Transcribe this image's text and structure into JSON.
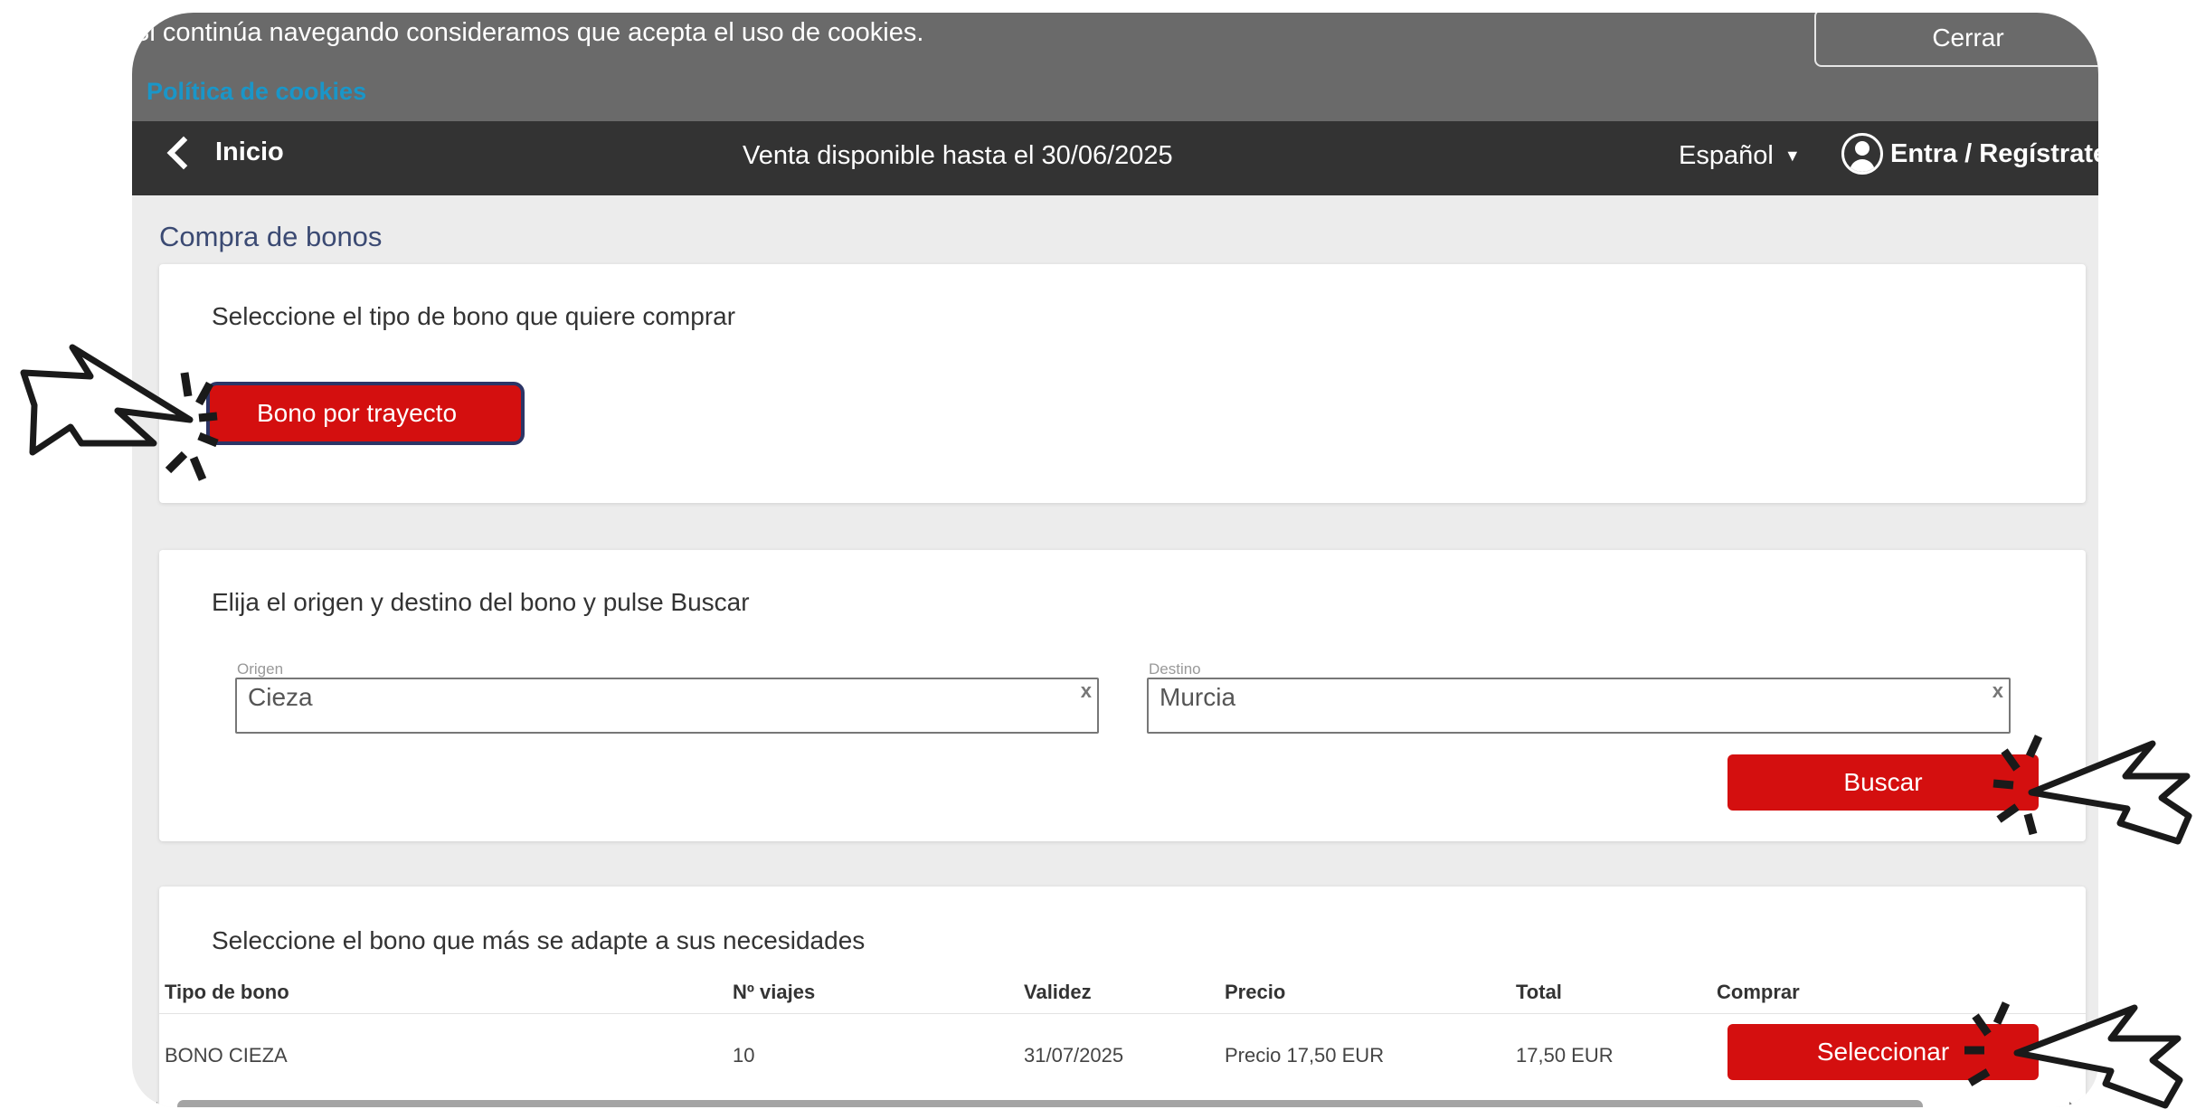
{
  "cookie": {
    "text": "Si continúa navegando consideramos que acepta el uso de cookies.",
    "policy_link": "Política de cookies",
    "close_label": "Cerrar"
  },
  "nav": {
    "back_label": "Inicio",
    "center_text": "Venta disponible hasta el 30/06/2025",
    "language": "Español",
    "login_label": "Entra / Regístrate"
  },
  "page": {
    "title": "Compra de bonos"
  },
  "step1": {
    "heading": "Seleccione el tipo de bono que quiere comprar",
    "bono_button": "Bono por trayecto"
  },
  "step2": {
    "heading": "Elija el origen y destino del bono y pulse Buscar",
    "origin_label": "Origen",
    "origin_value": "Cieza",
    "destination_label": "Destino",
    "destination_value": "Murcia",
    "clear_symbol": "x",
    "search_button": "Buscar"
  },
  "step3": {
    "heading": "Seleccione el bono que más se adapte a sus necesidades",
    "columns": [
      "Tipo de bono",
      "Nº viajes",
      "Validez",
      "Precio",
      "Total",
      "Comprar"
    ],
    "rows": [
      {
        "tipo": "BONO CIEZA",
        "viajes": "10",
        "validez": "31/07/2025",
        "precio": "Precio 17,50 EUR",
        "total": "17,50 EUR",
        "action": "Seleccionar"
      }
    ]
  },
  "colors": {
    "accent_red": "#d40f0f",
    "dark_nav": "#333333",
    "cookie_bar": "#6a6a6a",
    "link_blue": "#1a96c8"
  },
  "icons": [
    "chevron-left-icon",
    "user-icon",
    "caret-down-icon",
    "clear-icon",
    "pointer-hand-icon",
    "click-burst-icon"
  ]
}
